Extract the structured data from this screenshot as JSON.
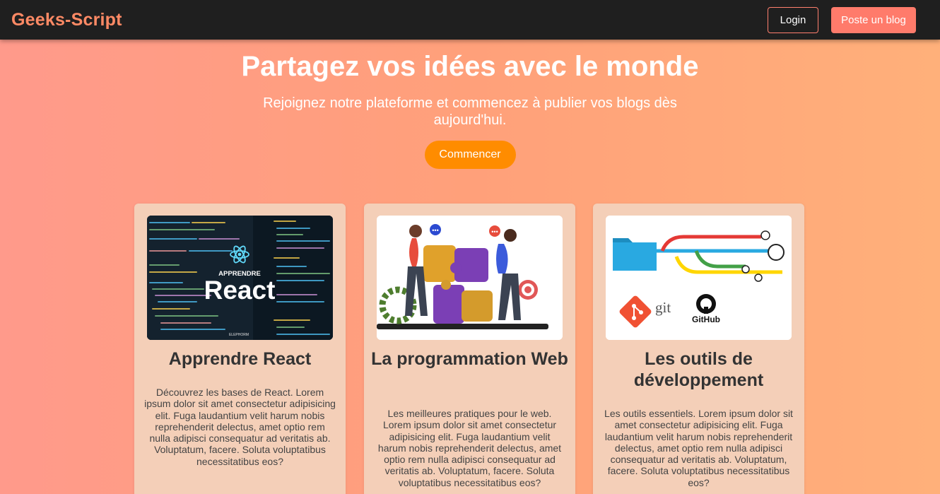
{
  "navbar": {
    "logo": "Geeks-Script",
    "login_label": "Login",
    "post_label": "Poste un blog"
  },
  "hero": {
    "title": "Partagez vos idées avec le monde",
    "subtitle": "Rejoignez notre plateforme et commencez à publier vos blogs dès aujourd'hui.",
    "cta_label": "Commencer"
  },
  "cards": [
    {
      "image_label_top": "APPRENDRE",
      "image_label_main": "React",
      "image_label_footer": "ELEPHORM",
      "title": "Apprendre React",
      "description": "Découvrez les bases de React. Lorem ipsum dolor sit amet consectetur adipisicing elit. Fuga laudantium velit harum nobis reprehenderit delectus, amet optio rem nulla adipisci consequatur ad veritatis ab. Voluptatum, facere. Soluta voluptatibus necessitatibus eos?"
    },
    {
      "title": "La programmation Web",
      "description": "Les meilleures pratiques pour le web. Lorem ipsum dolor sit amet consectetur adipisicing elit. Fuga laudantium velit harum nobis reprehenderit delectus, amet optio rem nulla adipisci consequatur ad veritatis ab. Voluptatum, facere. Soluta voluptatibus necessitatibus eos?"
    },
    {
      "image_label_git": "git",
      "image_label_github": "GitHub",
      "title": "Les outils de développement",
      "description": "Les outils essentiels. Lorem ipsum dolor sit amet consectetur adipisicing elit. Fuga laudantium velit harum nobis reprehenderit delectus, amet optio rem nulla adipisci consequatur ad veritatis ab. Voluptatum, facere. Soluta voluptatibus necessitatibus eos?"
    }
  ],
  "colors": {
    "navbar_bg": "#1f1f1f",
    "logo": "#ff8a65",
    "accent": "#ff7b6b",
    "cta": "#ff8c00",
    "card_bg": "#f4cfb8"
  },
  "icons": {
    "card1": "react-atom-icon",
    "card2": "puzzle-teamwork-illustration",
    "card3": "git-branch-diagram-icon"
  }
}
